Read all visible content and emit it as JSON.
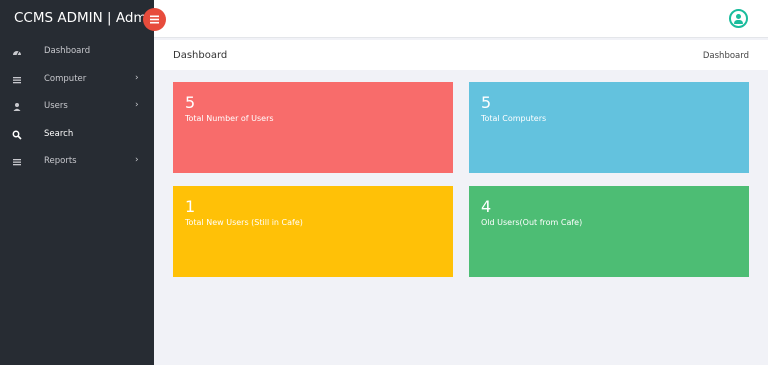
{
  "brand": {
    "title": "CCMS ADMIN | Admin"
  },
  "sidebar": {
    "items": [
      {
        "label": "Dashboard",
        "icon": "dashboard-icon",
        "has_submenu": false
      },
      {
        "label": "Computer",
        "icon": "computer-icon",
        "has_submenu": true
      },
      {
        "label": "Users",
        "icon": "user-icon",
        "has_submenu": true
      },
      {
        "label": "Search",
        "icon": "search-icon",
        "has_submenu": false
      },
      {
        "label": "Reports",
        "icon": "reports-icon",
        "has_submenu": true
      }
    ]
  },
  "header": {
    "page_title": "Dashboard",
    "breadcrumb": "Dashboard"
  },
  "cards": [
    {
      "value": "5",
      "label": "Total Number of Users",
      "color": "#f86c6b"
    },
    {
      "value": "5",
      "label": "Total Computers",
      "color": "#63c2de"
    },
    {
      "value": "1",
      "label": "Total New Users (Still in Cafe)",
      "color": "#ffc107"
    },
    {
      "value": "4",
      "label": "Old Users(Out from Cafe)",
      "color": "#4dbd74"
    }
  ],
  "colors": {
    "sidebar_bg": "#272c33",
    "menu_toggle": "#e74c3c",
    "user_icon": "#1abc9c",
    "content_bg": "#f1f2f7"
  }
}
